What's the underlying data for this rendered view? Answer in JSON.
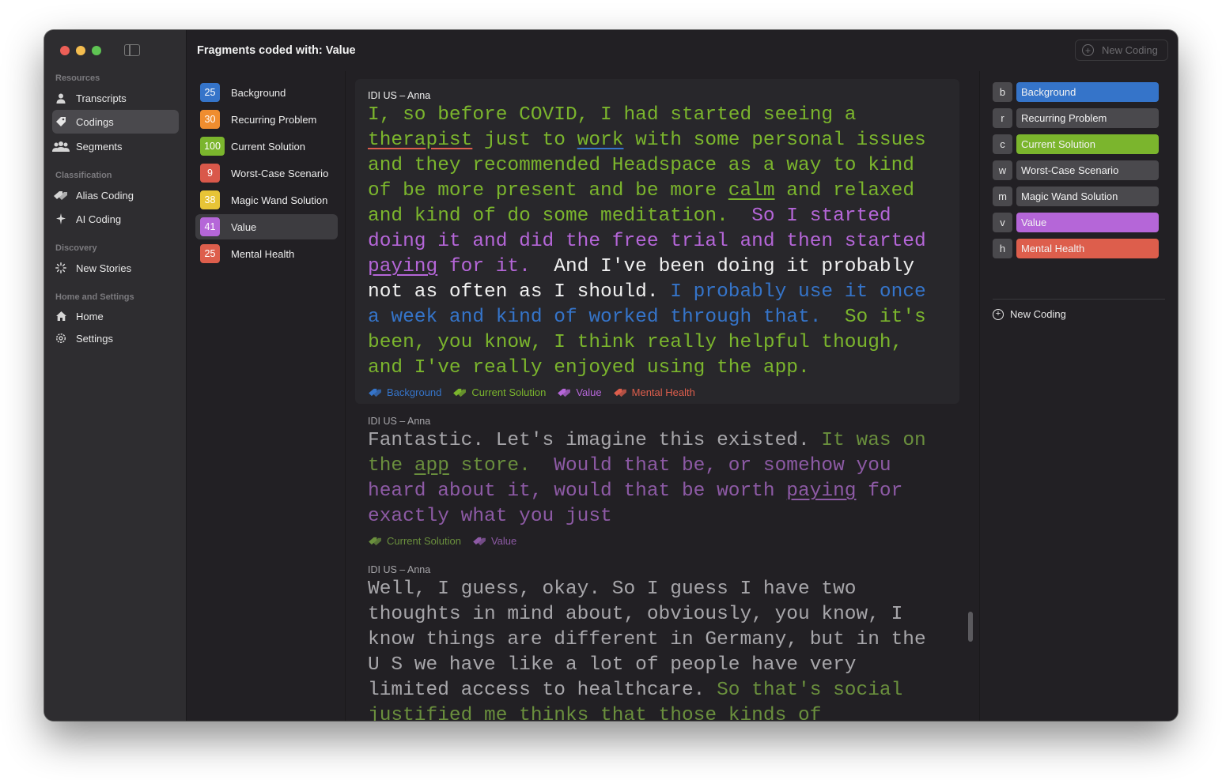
{
  "window": {
    "title": "Fragments coded with: Value",
    "new_coding_top": "New Coding"
  },
  "colors": {
    "background": "#3574c9",
    "recurring_problem": "#ef8d2f",
    "current_solution": "#7bb52d",
    "worst_case": "#d9584a",
    "magic_wand": "#e7c436",
    "value": "#b566d8",
    "mental_health": "#dd5e4c",
    "neutral_tag": "#4a494d"
  },
  "sidebar": {
    "sections": [
      "Resources",
      "Classification",
      "Discovery",
      "Home and Settings"
    ],
    "items": [
      {
        "label": "Transcripts",
        "icon": "person-icon"
      },
      {
        "label": "Codings",
        "icon": "tag-icon"
      },
      {
        "label": "Segments",
        "icon": "people-icon"
      },
      {
        "label": "Alias Coding",
        "icon": "alias-icon"
      },
      {
        "label": "AI Coding",
        "icon": "sparkle-icon"
      },
      {
        "label": "New Stories",
        "icon": "spinner-icon"
      },
      {
        "label": "Home",
        "icon": "house-icon"
      },
      {
        "label": "Settings",
        "icon": "gear-icon"
      }
    ]
  },
  "codings": [
    {
      "count": "25",
      "label": "Background"
    },
    {
      "count": "30",
      "label": "Recurring Problem"
    },
    {
      "count": "100",
      "label": "Current Solution"
    },
    {
      "count": "9",
      "label": "Worst-Case Scenario"
    },
    {
      "count": "38",
      "label": "Magic Wand Solution"
    },
    {
      "count": "41",
      "label": "Value"
    },
    {
      "count": "25",
      "label": "Mental Health"
    }
  ],
  "fragments": [
    {
      "source": "IDI US – Anna",
      "segments": [
        {
          "t": "I, so before COVID, I had started seeing a ",
          "c": "current_solution"
        },
        {
          "t": "therapist",
          "c": "current_solution",
          "u": "mental_health"
        },
        {
          "t": " just to ",
          "c": "current_solution"
        },
        {
          "t": "work",
          "c": "current_solution",
          "u": "background"
        },
        {
          "t": " with some personal issues and they recommended Headspace as a way to kind of be more present and be more ",
          "c": "current_solution"
        },
        {
          "t": "calm",
          "c": "current_solution",
          "u": "current_solution"
        },
        {
          "t": " and relaxed and kind of do some meditation.  ",
          "c": "current_solution"
        },
        {
          "t": "So I started doing it and did the free trial and then started ",
          "c": "value"
        },
        {
          "t": "paying",
          "c": "value",
          "u": "value"
        },
        {
          "t": " for it.  ",
          "c": "value"
        },
        {
          "t": "And I've been doing it probably not as often as I should. ",
          "c": "plain"
        },
        {
          "t": "I probably use it once a week and kind of worked through that.  ",
          "c": "background"
        },
        {
          "t": "So it's been, you know, I think really helpful though, and I've really enjoyed using the app.",
          "c": "current_solution"
        }
      ],
      "tags": [
        {
          "label": "Background",
          "c": "background"
        },
        {
          "label": "Current Solution",
          "c": "current_solution"
        },
        {
          "label": "Value",
          "c": "value"
        },
        {
          "label": "Mental Health",
          "c": "mental_health"
        }
      ]
    },
    {
      "source": "IDI US – Anna",
      "segments": [
        {
          "t": "Fantastic. Let's imagine this existed. ",
          "c": "dim_plain"
        },
        {
          "t": "It was on the ",
          "c": "dim_current"
        },
        {
          "t": "app",
          "c": "dim_current",
          "u": "dim_current"
        },
        {
          "t": " store.  ",
          "c": "dim_current"
        },
        {
          "t": "Would that be, or somehow you heard about it, would that be worth ",
          "c": "dim_value"
        },
        {
          "t": "paying",
          "c": "dim_value",
          "u": "dim_value"
        },
        {
          "t": " for exactly what you just",
          "c": "dim_value"
        }
      ],
      "tags": [
        {
          "label": "Current Solution",
          "c": "dim_current"
        },
        {
          "label": "Value",
          "c": "dim_value"
        }
      ]
    },
    {
      "source": "IDI US – Anna",
      "segments": [
        {
          "t": "Well, I guess, okay. So I guess I have two thoughts in mind about, obviously, you know, I know things are different in Germany, but in the U S we have like a lot of people have very limited access to healthcare. ",
          "c": "dim_plain"
        },
        {
          "t": "So that's social justified me thinks that those kinds of healthcare",
          "c": "dim_current"
        }
      ],
      "tags": []
    }
  ],
  "shortcuts": [
    {
      "key": "b",
      "label": "Background",
      "c": "background"
    },
    {
      "key": "r",
      "label": "Recurring Problem",
      "c": "neutral_tag"
    },
    {
      "key": "c",
      "label": "Current Solution",
      "c": "current_solution"
    },
    {
      "key": "w",
      "label": "Worst-Case Scenario",
      "c": "neutral_tag"
    },
    {
      "key": "m",
      "label": "Magic Wand Solution",
      "c": "neutral_tag"
    },
    {
      "key": "v",
      "label": "Value",
      "c": "value"
    },
    {
      "key": "h",
      "label": "Mental Health",
      "c": "mental_health"
    }
  ],
  "right_panel": {
    "new_coding": "New Coding"
  }
}
